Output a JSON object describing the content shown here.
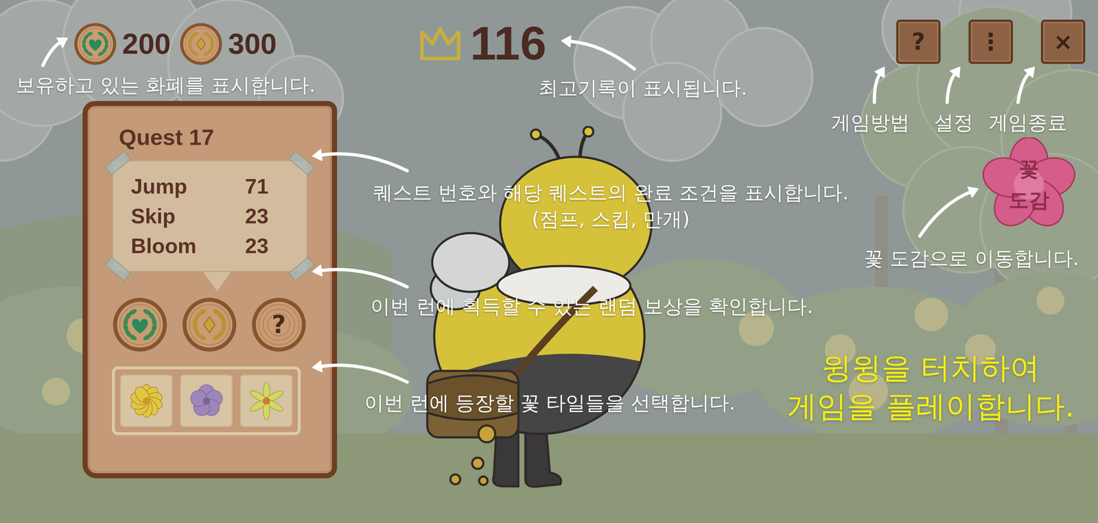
{
  "currency": [
    {
      "kind": "heart",
      "amount": "200"
    },
    {
      "kind": "diamond",
      "amount": "300"
    }
  ],
  "best_score": "116",
  "top_buttons": [
    {
      "icon": "?",
      "label": "게임방법"
    },
    {
      "icon": "⋮",
      "label": "설정"
    },
    {
      "icon": "×",
      "label": "게임종료"
    }
  ],
  "encyclopedia": {
    "lines": [
      "꽃",
      "도감"
    ]
  },
  "quest": {
    "title": "Quest 17",
    "conditions": [
      {
        "name": "Jump",
        "count": "71"
      },
      {
        "name": "Skip",
        "count": "23"
      },
      {
        "name": "Bloom",
        "count": "23"
      }
    ],
    "rewards": [
      {
        "kind": "heart"
      },
      {
        "kind": "diamond"
      },
      {
        "kind": "mystery",
        "icon": "?"
      }
    ],
    "flower_tiles": [
      {
        "kind": "ruffle",
        "color": "#e2c640"
      },
      {
        "kind": "petal",
        "color": "#9d86bb"
      },
      {
        "kind": "star",
        "color": "#d3d862"
      }
    ]
  },
  "annotations": {
    "currency": "보유하고 있는 화폐를 표시합니다.",
    "best_score": "최고기록이 표시됩니다.",
    "quest": [
      "퀘스트 번호와 해당 퀘스트의 완료 조건을 표시합니다.",
      "(점프, 스킵, 만개)"
    ],
    "rewards": "이번 런에 획득할 수 있는 랜덤 보상을 확인합니다.",
    "tiles": "이번 런에 등장할 꽃 타일들을 선택합니다.",
    "encyclopedia": "꽃 도감으로 이동합니다."
  },
  "play_hint": [
    "윙윙을 터치하여",
    "게임을 플레이합니다."
  ]
}
